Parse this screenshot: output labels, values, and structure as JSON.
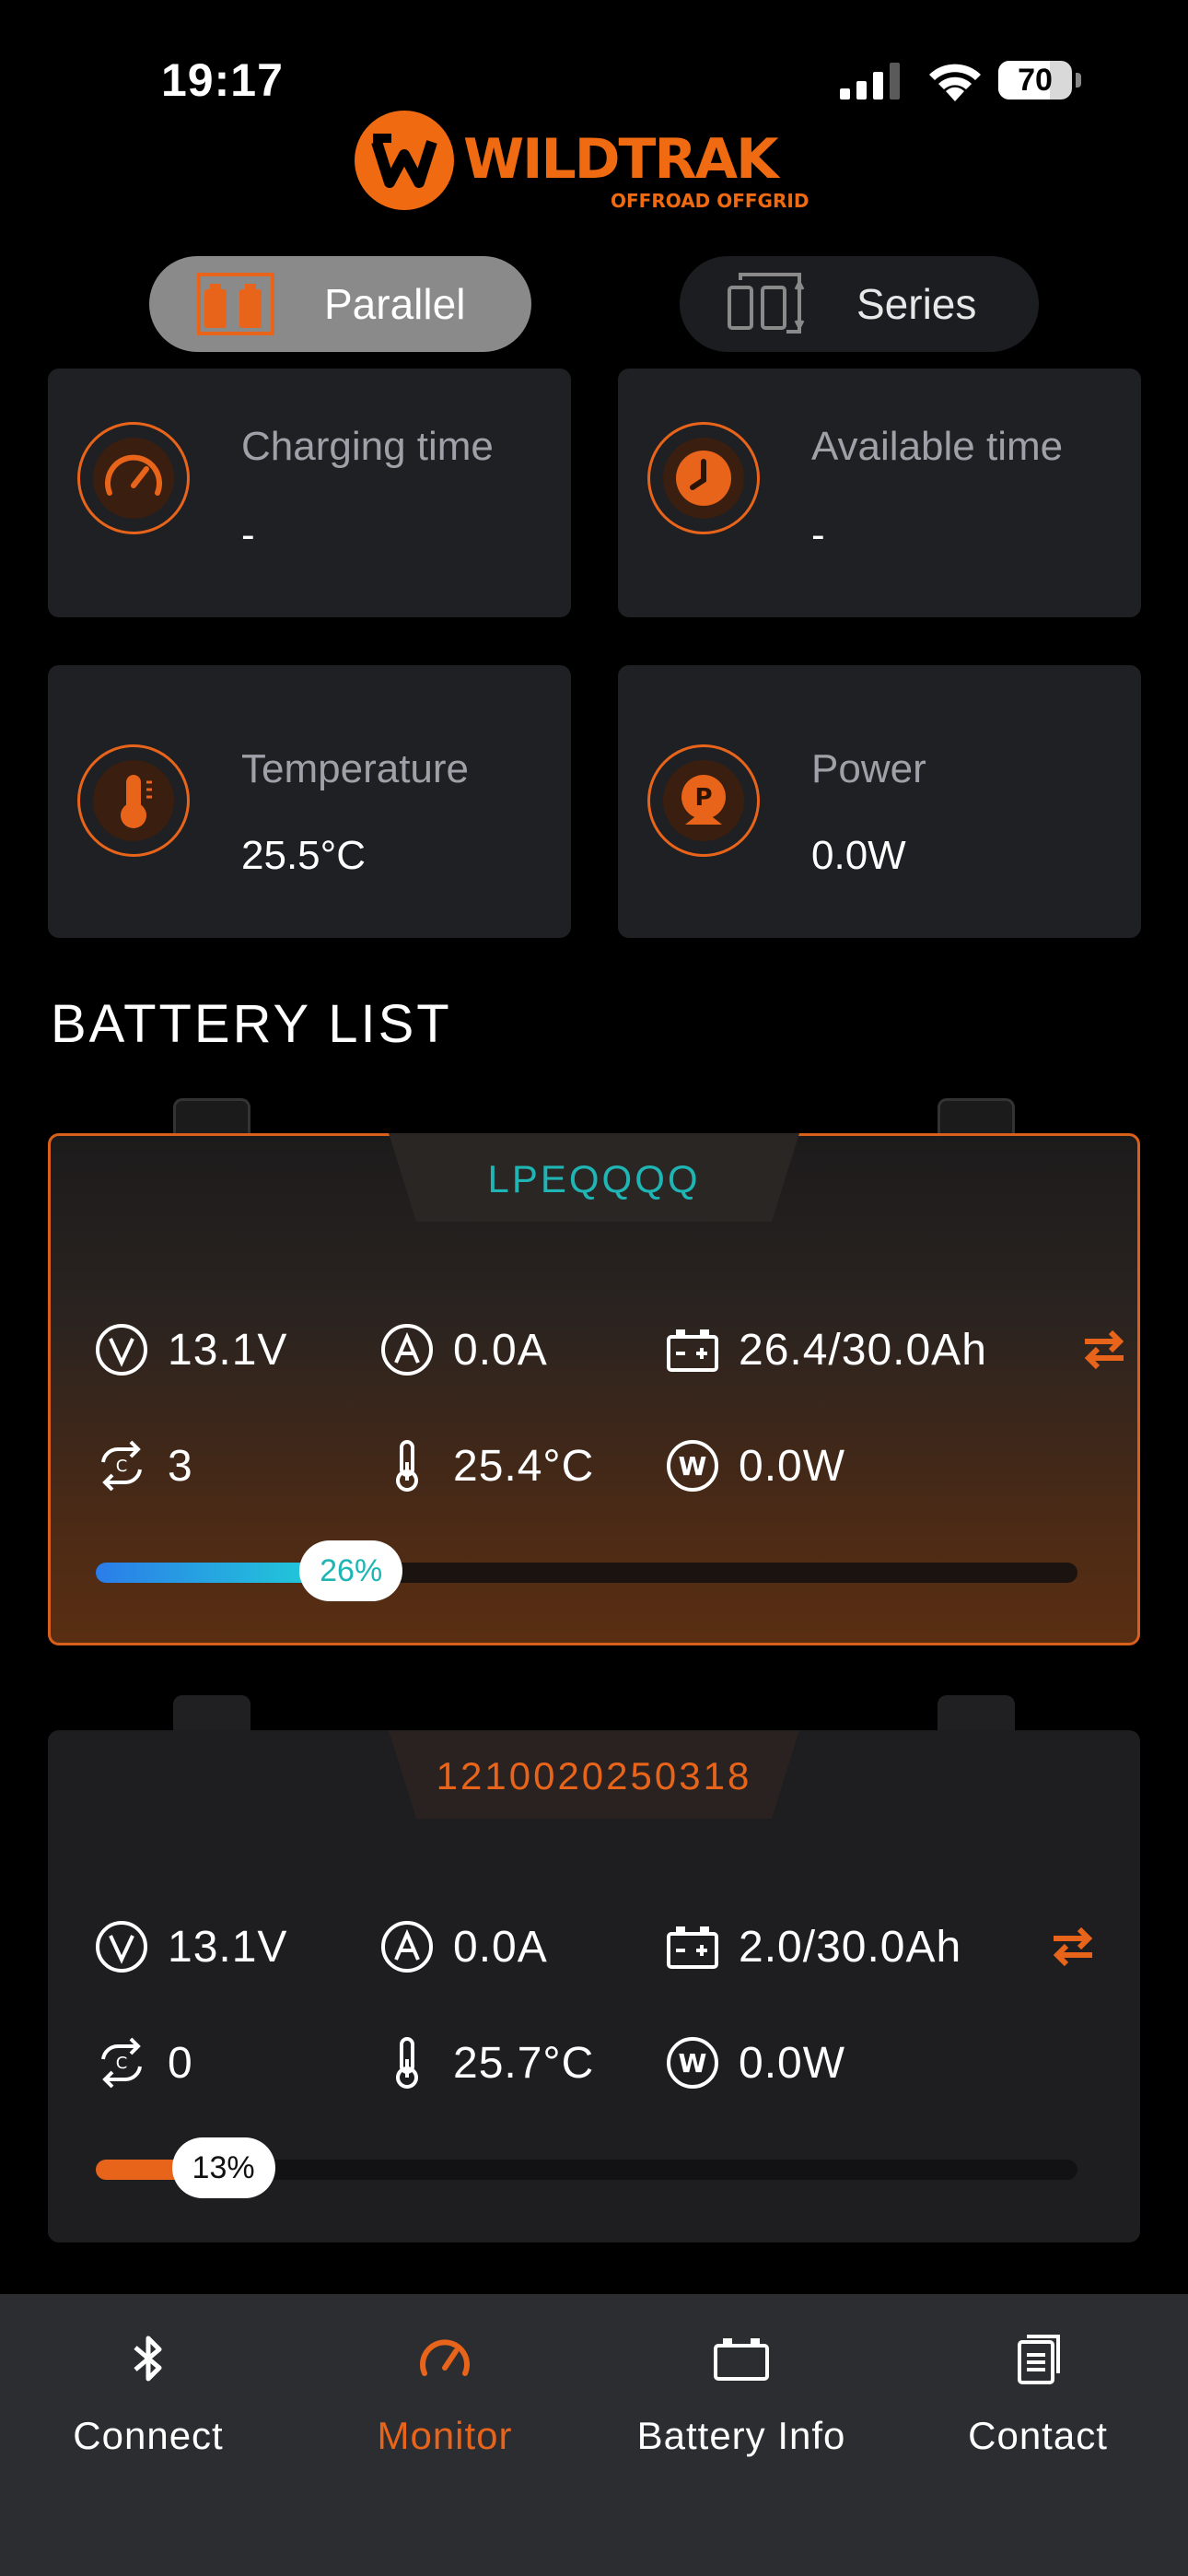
{
  "status_bar": {
    "time": "19:17",
    "battery_percent": "70",
    "battery_level": 0.7
  },
  "logo": {
    "name": "WILDTRAK",
    "tagline": "OFFROAD OFFGRID"
  },
  "mode_toggle": {
    "options": [
      {
        "label": "Parallel",
        "selected": true
      },
      {
        "label": "Series",
        "selected": false
      }
    ]
  },
  "stats": {
    "charging_time": {
      "title": "Charging time",
      "value": "-"
    },
    "available_time": {
      "title": "Available time",
      "value": "-"
    },
    "temperature": {
      "title": "Temperature",
      "value": "25.5°C"
    },
    "power": {
      "title": "Power",
      "value": "0.0W"
    }
  },
  "battery_list": {
    "title": "BATTERY LIST",
    "batteries": [
      {
        "name": "LPEQQQQ",
        "voltage": "13.1V",
        "current": "0.0A",
        "capacity": "26.4/30.0Ah",
        "cycles": "3",
        "temperature": "25.4°C",
        "power": "0.0W",
        "percent_label": "26%",
        "percent": 0.26
      },
      {
        "name": "1210020250318",
        "voltage": "13.1V",
        "current": "0.0A",
        "capacity": "2.0/30.0Ah",
        "cycles": "0",
        "temperature": "25.7°C",
        "power": "0.0W",
        "percent_label": "13%",
        "percent": 0.13
      }
    ]
  },
  "colors": {
    "accent": "#e8641a",
    "teal": "#1fb5b5",
    "card_bg": "#1e2024",
    "nav_bg": "#2b2d31"
  },
  "nav": {
    "items": [
      {
        "label": "Connect",
        "icon": "bluetooth-icon"
      },
      {
        "label": "Monitor",
        "icon": "gauge-icon",
        "active": true
      },
      {
        "label": "Battery Info",
        "icon": "battery-icon"
      },
      {
        "label": "Contact",
        "icon": "document-icon"
      }
    ]
  }
}
